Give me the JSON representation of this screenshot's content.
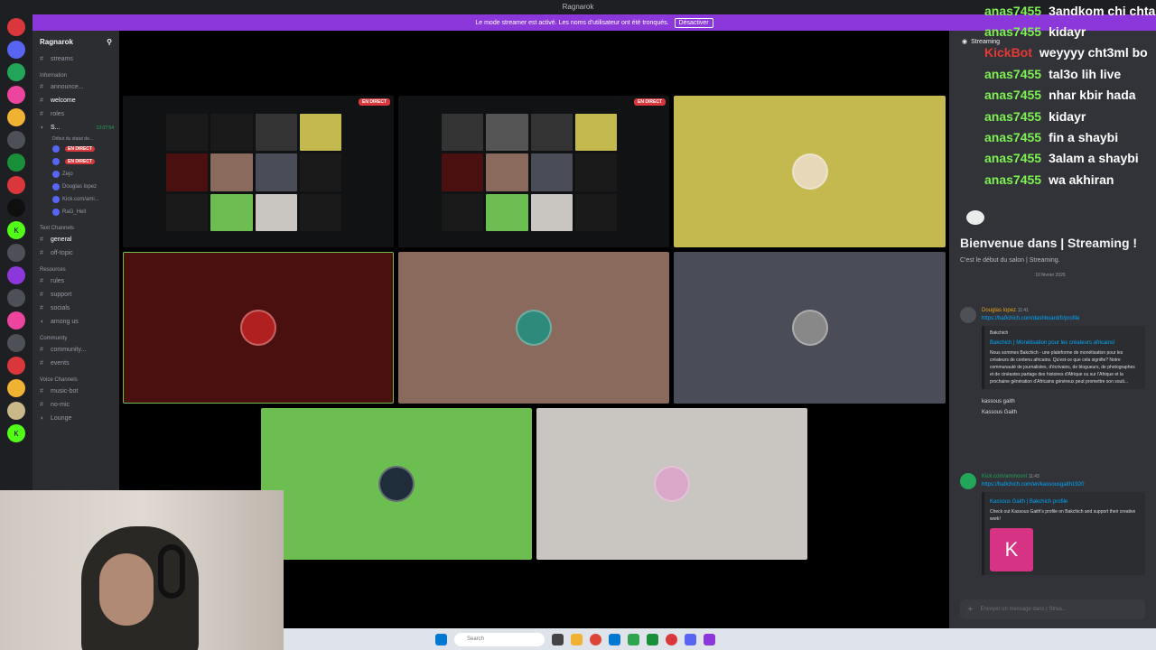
{
  "window": {
    "title": "Ragnarok"
  },
  "banner": {
    "text": "Le mode streamer est activé. Les noms d'utilisateur ont été tronqués.",
    "button": "Désactiver"
  },
  "server": {
    "name": "Ragnarok"
  },
  "channels": {
    "top": [
      {
        "icon": "#",
        "label": "streams"
      }
    ],
    "categories": [
      {
        "name": "Information",
        "items": [
          "announce...",
          "welcome",
          "roles"
        ]
      },
      {
        "name": "Text Channels",
        "items": [
          "general",
          "off-topic"
        ]
      },
      {
        "name": "Resources",
        "items": [
          "rules",
          "support",
          "socials",
          "among us"
        ]
      },
      {
        "name": "Community",
        "items": [
          "community...",
          "events"
        ]
      },
      {
        "name": "Voice Channels",
        "items": [
          "music-bot",
          "no-mic",
          "Lounge"
        ]
      }
    ],
    "voice_channel": {
      "name": "S...",
      "time": "13:07:54",
      "sub": "Début du statut de...",
      "users": [
        "",
        "",
        "Zejo",
        "Douglas lopez",
        "Kick.com/ami...",
        "RaG_Hell"
      ],
      "live_label": "EN DIRECT"
    }
  },
  "stage": {
    "live_label": "EN DIRECT"
  },
  "chat": {
    "header": "Streaming",
    "welcome_title": "Bienvenue dans | Streaming !",
    "welcome_sub": "C'est le début du salon | Streaming.",
    "date": "10 février 2026",
    "messages": [
      {
        "user": "Douglas lopez",
        "time": "11:41",
        "link": "https://ba9chich.com/dashboard/fr/profile",
        "embed_provider": "Bakchich",
        "embed_title": "Bakchich | Monétisation pour les créateurs africains!",
        "embed_desc": "Nous sommes Bakchich - une plateforme de monétisation pour les créateurs de contenu africains. Qu'est-ce que cela signifie? Notre communauté de journalistes, d'écrivains, de blogueurs, de photographes et de cinéastes partage des histoires d'Afrique ou sur l'Afrique et la prochaine génération d'Africains généreux peut promettre son souti...",
        "extra1": "kassous gaith",
        "extra2": "Kassous Gaith"
      },
      {
        "user": "Kick.com/aminosnl",
        "time": "11:43",
        "link": "https://ba9chich.com/en/kassousgaith1920",
        "embed_title": "Kassous Gaith | Bakchich profile",
        "embed_desc": "Check out Kassous Gaith's profile on Bakchich and support their creative work!",
        "thumb": "K"
      }
    ],
    "input_placeholder": "Envoyer un message dans | Strea..."
  },
  "overlay_chat": [
    {
      "user": "anas7455",
      "text": "3andkom chi chta"
    },
    {
      "user": "anas7455",
      "text": "kidayr"
    },
    {
      "user": "KickBot",
      "text": "weyyyy cht3ml bo",
      "bot": true
    },
    {
      "user": "anas7455",
      "text": "tal3o lih live"
    },
    {
      "user": "anas7455",
      "text": "nhar kbir hada"
    },
    {
      "user": "anas7455",
      "text": "kidayr"
    },
    {
      "user": "anas7455",
      "text": "fin a shaybi"
    },
    {
      "user": "anas7455",
      "text": "3alam a shaybi"
    },
    {
      "user": "anas7455",
      "text": "wa akhiran"
    }
  ],
  "taskbar": {
    "search": "Search"
  },
  "colors": {
    "tile_olive": "#c3b94e",
    "tile_maroon": "#4a1010",
    "tile_brown": "#8a6a5c",
    "tile_slate": "#4a4c58",
    "tile_green": "#6cbe50",
    "tile_grey": "#c9c5c0"
  }
}
